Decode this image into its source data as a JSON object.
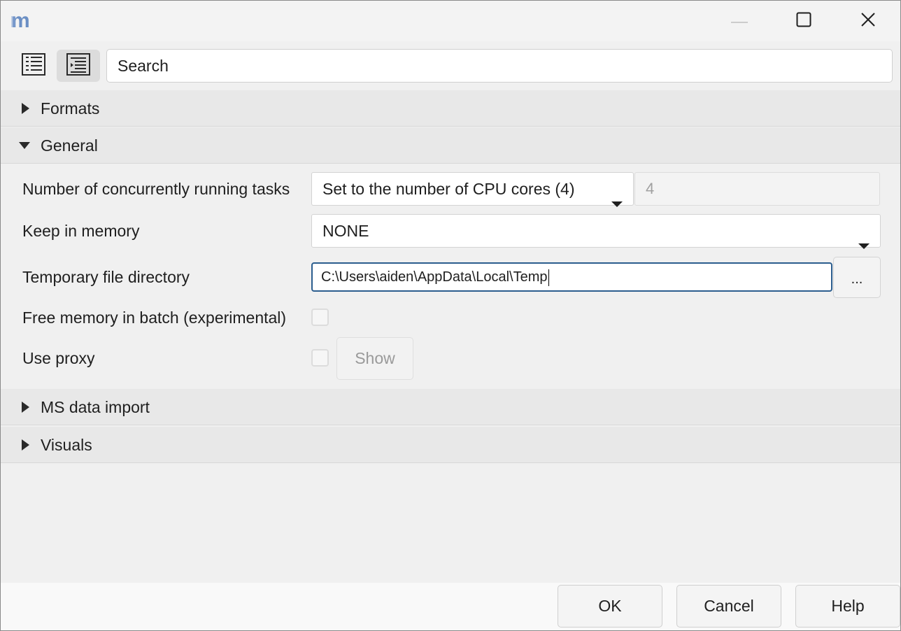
{
  "window": {
    "logo_text": "m",
    "controls": {
      "minimize_icon": "minimize-icon",
      "maximize_icon": "maximize-icon",
      "close_icon": "close-icon"
    }
  },
  "toolbar": {
    "buttons": [
      "list-view-icon",
      "indented-list-icon"
    ],
    "search": {
      "value": "Search"
    }
  },
  "sections": {
    "formats": {
      "label": "Formats",
      "expanded": false
    },
    "general": {
      "label": "General",
      "expanded": true
    },
    "ms_data_import": {
      "label": "MS data import",
      "expanded": false
    },
    "visuals": {
      "label": "Visuals",
      "expanded": false
    }
  },
  "general": {
    "concurrent_tasks": {
      "label": "Number of concurrently running tasks",
      "selected": "Set to the number of CPU cores (4)",
      "value": "4"
    },
    "keep_in_memory": {
      "label": "Keep in memory",
      "selected": "NONE"
    },
    "temp_dir": {
      "label": "Temporary file directory",
      "value": "C:\\Users\\aiden\\AppData\\Local\\Temp",
      "browse_label": "..."
    },
    "free_memory_batch": {
      "label": "Free memory in batch (experimental)",
      "checked": false
    },
    "use_proxy": {
      "label": "Use proxy",
      "checked": false,
      "show_label": "Show"
    }
  },
  "footer": {
    "ok_label": "OK",
    "cancel_label": "Cancel",
    "help_label": "Help"
  },
  "colors": {
    "focus_border": "#2b5d8e",
    "section_header_bg": "#e8e8e8",
    "window_bg": "#f0f0f0"
  }
}
